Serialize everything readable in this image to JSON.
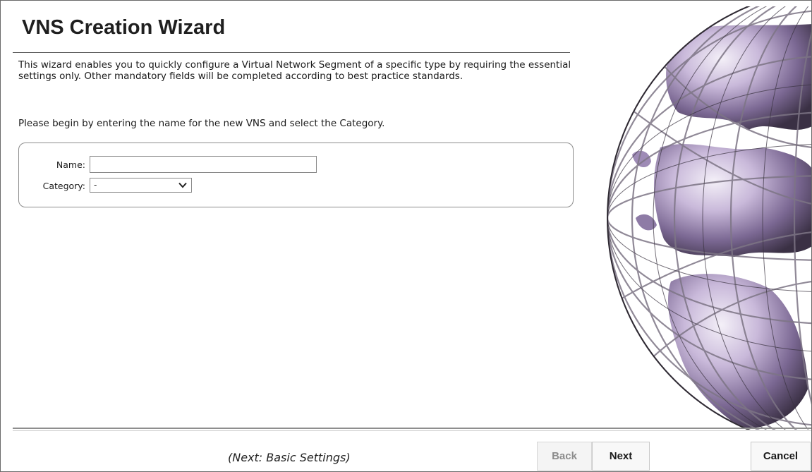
{
  "wizard": {
    "title": "VNS Creation Wizard",
    "intro": "This wizard enables you to quickly configure a Virtual Network Segment of a specific type by requiring the essential settings only. Other mandatory fields will be completed according to best practice standards.",
    "prompt": "Please begin by entering the name for the new VNS and select the Category."
  },
  "form": {
    "name_label": "Name:",
    "name_value": "",
    "category_label": "Category:",
    "category_selected": "-"
  },
  "footer": {
    "next_hint": "(Next: Basic Settings)",
    "back_label": "Back",
    "next_label": "Next",
    "cancel_label": "Cancel"
  },
  "icons": {
    "dropdown": "chevron-down-icon",
    "globe": "globe-image"
  },
  "colors": {
    "text": "#1a1a1a",
    "border": "#8c8c8c",
    "disabled_text": "#8c8c8c",
    "globe_accent": "#8a72a8"
  }
}
